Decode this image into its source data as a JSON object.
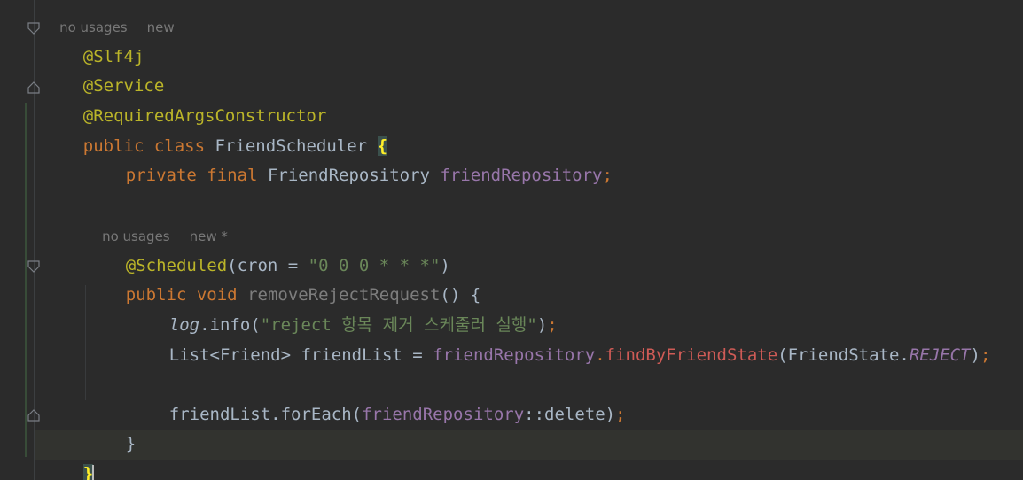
{
  "editor": {
    "top_hint": {
      "usages": "no usages",
      "status": "new"
    },
    "lines": {
      "ann_slf4j": "@Slf4j",
      "ann_service": "@Service",
      "ann_required": "@RequiredArgsConstructor",
      "class_kw_public": "public",
      "class_kw_class": "class",
      "class_name": "FriendScheduler",
      "open_brace": "{",
      "field_kw_private": "private",
      "field_kw_final": "final",
      "field_type": "FriendRepository",
      "field_name": "friendRepository",
      "semicolon": ";",
      "method_hint_usages": "no usages",
      "method_hint_status": "new *",
      "scheduled_ann": "@Scheduled",
      "scheduled_paren_open": "(cron = ",
      "scheduled_value": "\"0 0 0 * * *\"",
      "scheduled_paren_close": ")",
      "method_kw_public": "public",
      "method_kw_void": "void",
      "method_name": "removeRejectRequest",
      "method_sig_rest": "() {",
      "log_obj": "log",
      "log_call": ".info(",
      "log_msg": "\"reject 항목 제거 스케줄러 실행\"",
      "log_close": ")",
      "list_type": "List<Friend> friendList = ",
      "repo_ref": "friendRepository",
      "dot": ".",
      "find_method": "findByFriendState",
      "find_arg_open": "(FriendState.",
      "find_arg_const": "REJECT",
      "find_close": ")",
      "foreach_prefix": "friendList.forEach(",
      "foreach_ref": "friendRepository",
      "foreach_suffix": "::delete)",
      "method_close": "}",
      "class_close": "}"
    }
  },
  "colors": {
    "background": "#2b2b2b",
    "keyword": "#cc7832",
    "annotation": "#bbb529",
    "field": "#9876aa",
    "string": "#6a8759",
    "method_call": "#cf5b56"
  }
}
